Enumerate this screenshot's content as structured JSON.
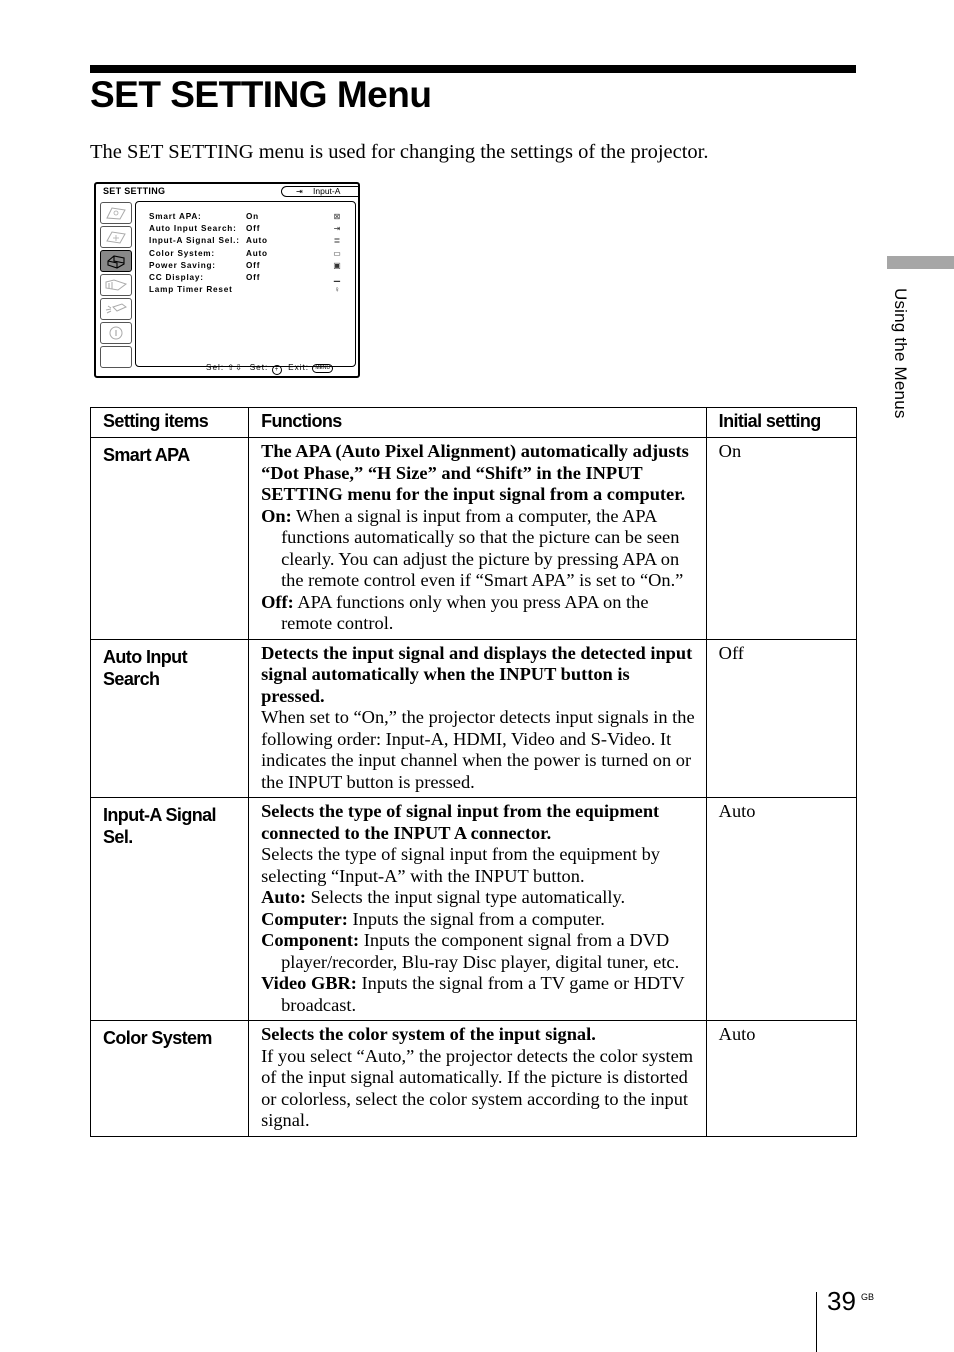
{
  "page": {
    "title": "SET SETTING Menu",
    "intro": "The SET SETTING menu is used for changing the settings of the projector.",
    "side_tab": "Using the Menus",
    "page_number": "39",
    "page_suffix": "GB"
  },
  "menu_screen": {
    "title": "SET SETTING",
    "input_indicator": "Input-A",
    "input_icon": "input-arrow-icon",
    "tabs": [
      {
        "icon": "picture-icon",
        "active": false
      },
      {
        "icon": "input-setting-icon",
        "active": false
      },
      {
        "icon": "set-setting-icon",
        "active": true
      },
      {
        "icon": "menu-setting-icon",
        "active": false
      },
      {
        "icon": "installation-icon",
        "active": false
      },
      {
        "icon": "information-icon",
        "active": false
      },
      {
        "icon": "blank-tab",
        "active": false
      }
    ],
    "rows": [
      {
        "name": "Smart APA:",
        "value": "On",
        "icon": "smart-apa-icon",
        "glyph": "⊠"
      },
      {
        "name": "Auto Input Search:",
        "value": "Off",
        "icon": "auto-input-search-icon",
        "glyph": "⇥"
      },
      {
        "name": "Input-A Signal Sel.:",
        "value": "Auto",
        "icon": "signal-select-icon",
        "glyph": "≣"
      },
      {
        "name": "Color System:",
        "value": "Auto",
        "icon": "color-system-icon",
        "glyph": "▭"
      },
      {
        "name": "Power Saving:",
        "value": "Off",
        "icon": "power-saving-icon",
        "glyph": "▣"
      },
      {
        "name": "CC Display:",
        "value": "Off",
        "icon": "cc-display-icon",
        "glyph": "▁"
      },
      {
        "name": "Lamp Timer Reset",
        "value": "",
        "icon": "lamp-timer-icon",
        "glyph": "♀"
      }
    ],
    "footer": {
      "sel_label": "Sel:",
      "sel_keys": "⇧⇩",
      "set_label": "Set:",
      "set_key": "+",
      "exit_label": "Exit:",
      "exit_key": "MENU"
    }
  },
  "table": {
    "headers": [
      "Setting items",
      "Functions",
      "Initial setting"
    ],
    "rows": [
      {
        "item": "Smart APA",
        "lead": "The APA (Auto Pixel Alignment) automatically adjusts “Dot Phase,” “H Size” and “Shift” in the INPUT SETTING menu for the input signal from a computer.",
        "body": "",
        "options": [
          {
            "label": "On:",
            "text": "When a signal is input from a computer, the APA functions automatically so that the picture can be seen clearly. You can adjust the picture by pressing APA on the remote control even if “Smart APA” is set to “On.”"
          },
          {
            "label": "Off:",
            "text": "APA functions only when you press APA on the remote control."
          }
        ],
        "initial": "On"
      },
      {
        "item": "Auto Input Search",
        "lead": "Detects the input signal and displays the detected input signal automatically when the INPUT button is pressed.",
        "body": "When set to “On,” the projector detects input signals in the following order: Input-A, HDMI, Video and S-Video. It indicates the input channel when the power is turned on or the INPUT button is pressed.",
        "options": [],
        "initial": "Off"
      },
      {
        "item": "Input-A Signal Sel.",
        "lead": "Selects the type of signal input from the equipment connected to the INPUT A connector.",
        "body": "Selects the type of signal input from the equipment by selecting “Input-A” with the INPUT button.",
        "options": [
          {
            "label": "Auto:",
            "text": "Selects the input signal type automatically."
          },
          {
            "label": "Computer:",
            "text": "Inputs the signal from a computer."
          },
          {
            "label": "Component:",
            "text": "Inputs the component signal from a DVD player/recorder, Blu-ray Disc player, digital tuner, etc."
          },
          {
            "label": "Video GBR:",
            "text": "Inputs the signal from a TV game or HDTV broadcast."
          }
        ],
        "initial": "Auto"
      },
      {
        "item": "Color System",
        "lead": "Selects the color system of the input signal.",
        "body": "If you select “Auto,” the projector detects the color system of the input signal automatically. If the picture is distorted or colorless, select the color system according to the input signal.",
        "options": [],
        "initial": "Auto"
      }
    ]
  }
}
